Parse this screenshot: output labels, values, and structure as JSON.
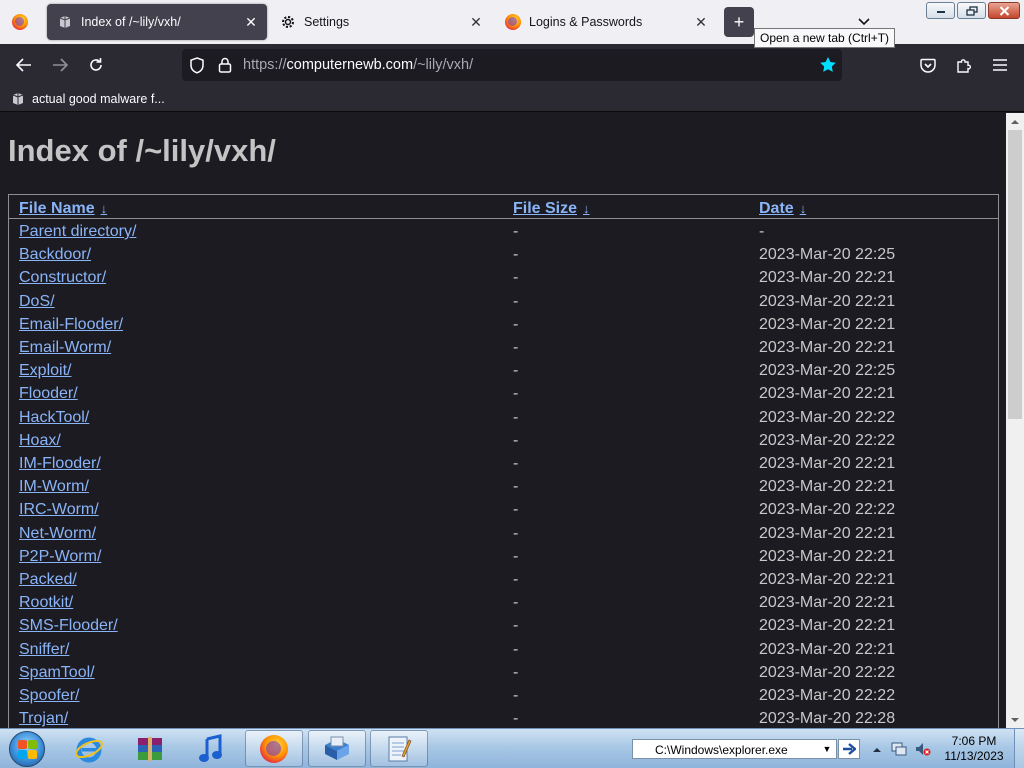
{
  "browser": {
    "tabs": [
      {
        "title": "Index of /~lily/vxh/",
        "icon": "page-icon",
        "active": true
      },
      {
        "title": "Settings",
        "icon": "gear-icon",
        "active": false
      },
      {
        "title": "Logins & Passwords",
        "icon": "firefox-icon",
        "active": false
      }
    ],
    "new_tab_tooltip": "Open a new tab (Ctrl+T)",
    "url": {
      "protocol": "https://",
      "domain": "computernewb.com",
      "path": "/~lily/vxh/"
    },
    "bookmarks": [
      {
        "label": "actual good malware f...",
        "icon": "page-icon"
      }
    ],
    "colors": {
      "accent_star": "#00ddff",
      "link": "#8ab4f8"
    }
  },
  "page": {
    "heading": "Index of /~lily/vxh/",
    "columns": {
      "name": "File Name",
      "size": "File Size",
      "date": "Date",
      "sort_arrow": "↓"
    },
    "rows": [
      {
        "name": "Parent directory/",
        "size": "-",
        "date": "-"
      },
      {
        "name": "Backdoor/",
        "size": "-",
        "date": "2023-Mar-20 22:25"
      },
      {
        "name": "Constructor/",
        "size": "-",
        "date": "2023-Mar-20 22:21"
      },
      {
        "name": "DoS/",
        "size": "-",
        "date": "2023-Mar-20 22:21"
      },
      {
        "name": "Email-Flooder/",
        "size": "-",
        "date": "2023-Mar-20 22:21"
      },
      {
        "name": "Email-Worm/",
        "size": "-",
        "date": "2023-Mar-20 22:21"
      },
      {
        "name": "Exploit/",
        "size": "-",
        "date": "2023-Mar-20 22:25"
      },
      {
        "name": "Flooder/",
        "size": "-",
        "date": "2023-Mar-20 22:21"
      },
      {
        "name": "HackTool/",
        "size": "-",
        "date": "2023-Mar-20 22:22"
      },
      {
        "name": "Hoax/",
        "size": "-",
        "date": "2023-Mar-20 22:22"
      },
      {
        "name": "IM-Flooder/",
        "size": "-",
        "date": "2023-Mar-20 22:21"
      },
      {
        "name": "IM-Worm/",
        "size": "-",
        "date": "2023-Mar-20 22:21"
      },
      {
        "name": "IRC-Worm/",
        "size": "-",
        "date": "2023-Mar-20 22:22"
      },
      {
        "name": "Net-Worm/",
        "size": "-",
        "date": "2023-Mar-20 22:21"
      },
      {
        "name": "P2P-Worm/",
        "size": "-",
        "date": "2023-Mar-20 22:21"
      },
      {
        "name": "Packed/",
        "size": "-",
        "date": "2023-Mar-20 22:21"
      },
      {
        "name": "Rootkit/",
        "size": "-",
        "date": "2023-Mar-20 22:21"
      },
      {
        "name": "SMS-Flooder/",
        "size": "-",
        "date": "2023-Mar-20 22:21"
      },
      {
        "name": "Sniffer/",
        "size": "-",
        "date": "2023-Mar-20 22:21"
      },
      {
        "name": "SpamTool/",
        "size": "-",
        "date": "2023-Mar-20 22:22"
      },
      {
        "name": "Spoofer/",
        "size": "-",
        "date": "2023-Mar-20 22:22"
      },
      {
        "name": "Trojan/",
        "size": "-",
        "date": "2023-Mar-20 22:28"
      }
    ]
  },
  "taskbar": {
    "apps": [
      "internet-explorer-icon",
      "winrar-icon",
      "itunes-icon",
      "firefox-icon",
      "explorer-icon",
      "notepad-icon"
    ],
    "run_box_value": "C:\\Windows\\explorer.exe",
    "clock": {
      "time": "7:06 PM",
      "date": "11/13/2023"
    }
  }
}
